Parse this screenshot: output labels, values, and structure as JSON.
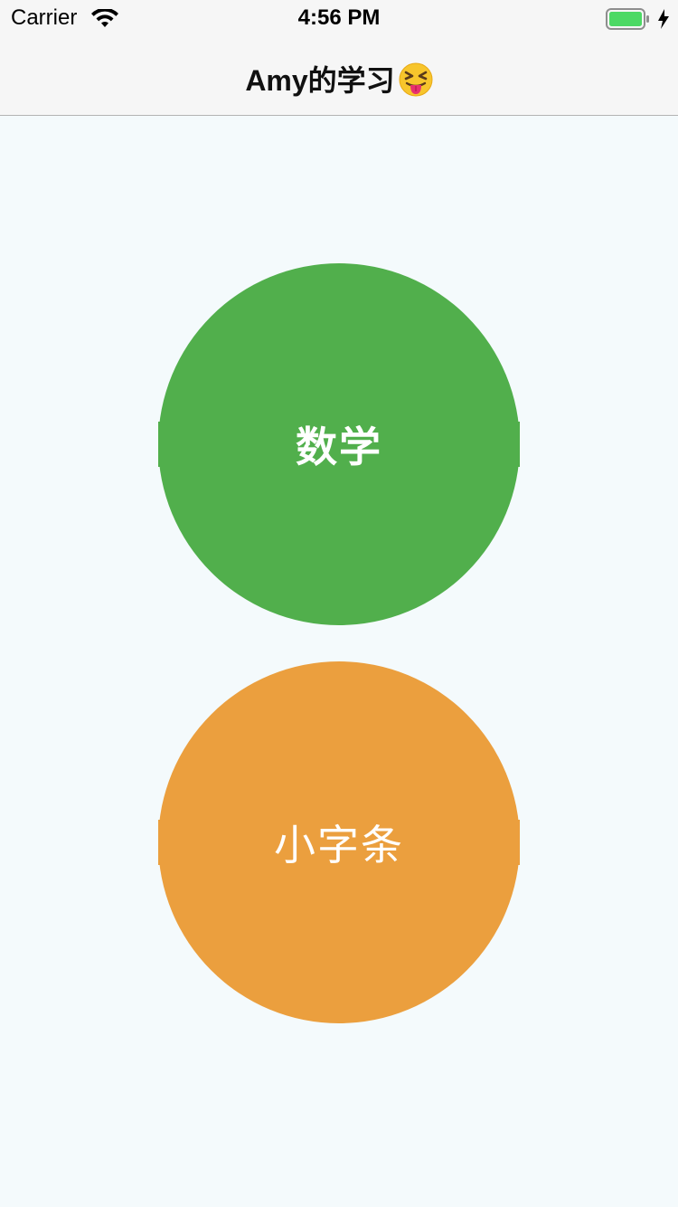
{
  "status_bar": {
    "carrier": "Carrier",
    "time": "4:56 PM",
    "battery_color": "#4cd964"
  },
  "nav": {
    "title": "Amy的学习",
    "emoji": "squinting-face-with-tongue-emoji"
  },
  "buttons": [
    {
      "label": "数学",
      "color": "#51af4c"
    },
    {
      "label": "小字条",
      "color": "#eb9f3e"
    }
  ]
}
